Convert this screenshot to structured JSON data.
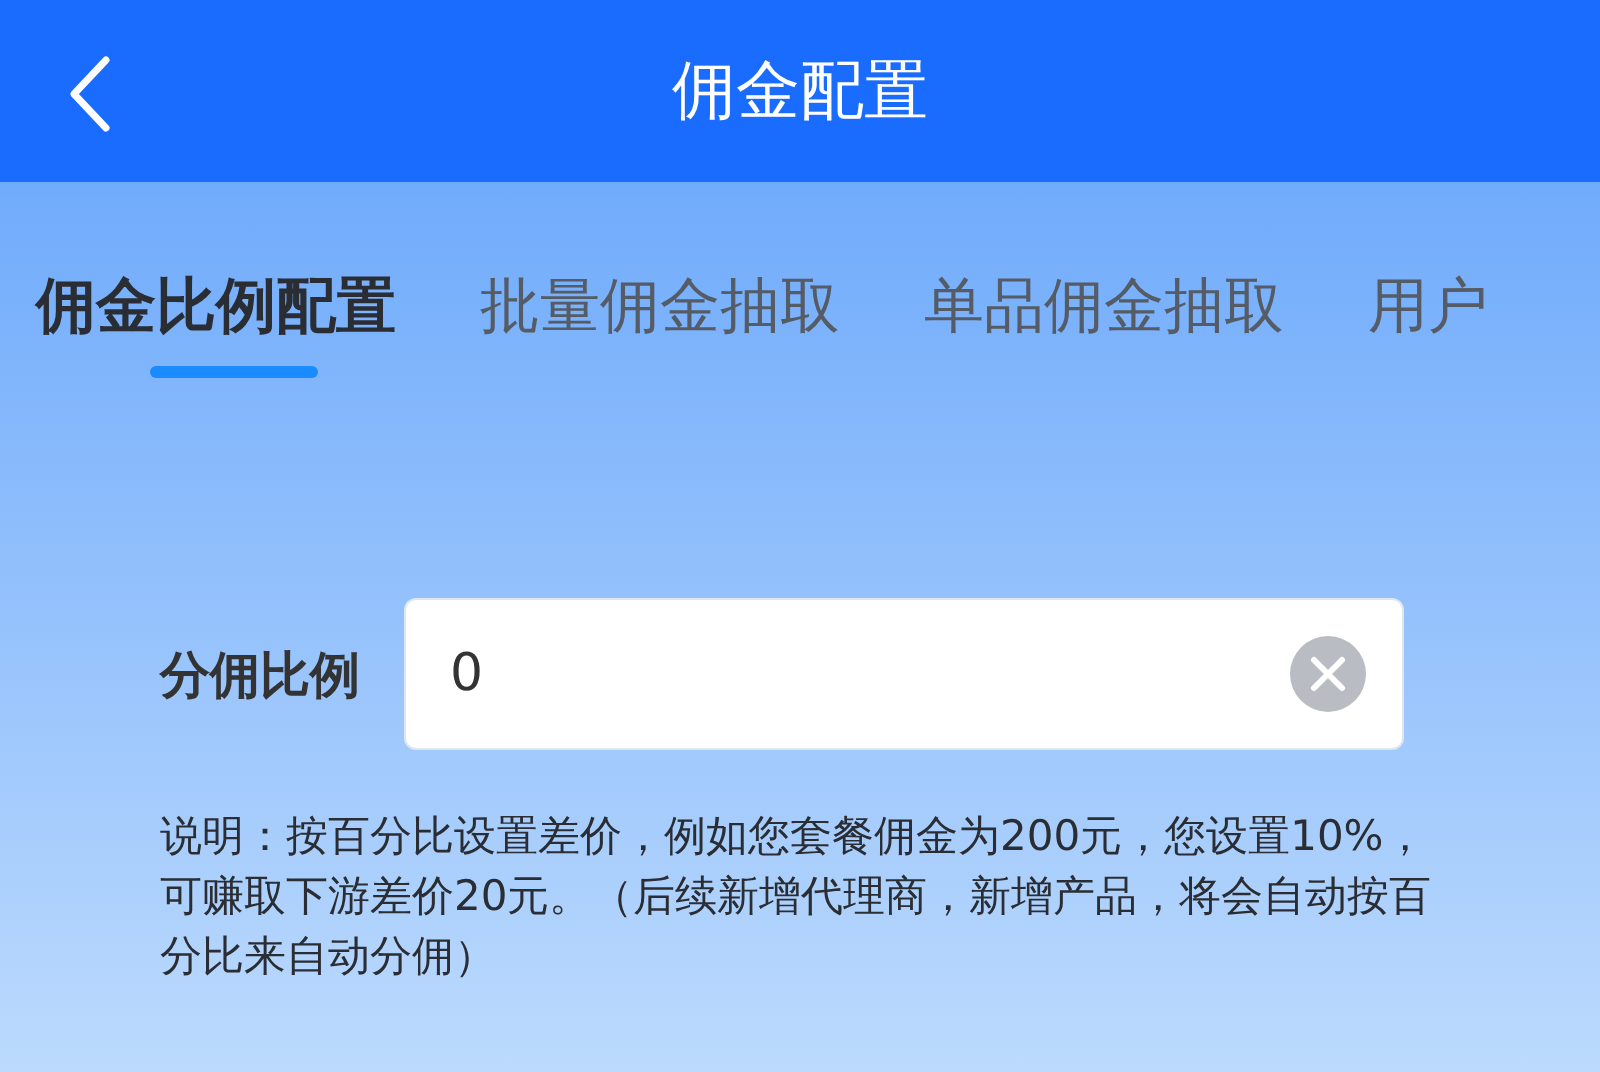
{
  "header": {
    "title": "佣金配置"
  },
  "tabs": [
    {
      "label": "佣金比例配置",
      "selected": true
    },
    {
      "label": "批量佣金抽取",
      "selected": false
    },
    {
      "label": "单品佣金抽取",
      "selected": false
    },
    {
      "label": "用户",
      "selected": false
    }
  ],
  "form": {
    "label": "分佣比例",
    "value": "0"
  },
  "note": "说明：按百分比设置差价，例如您套餐佣金为200元，您设置10%，可赚取下游差价20元。（后续新增代理商，新增产品，将会自动按百分比来自动分佣）"
}
